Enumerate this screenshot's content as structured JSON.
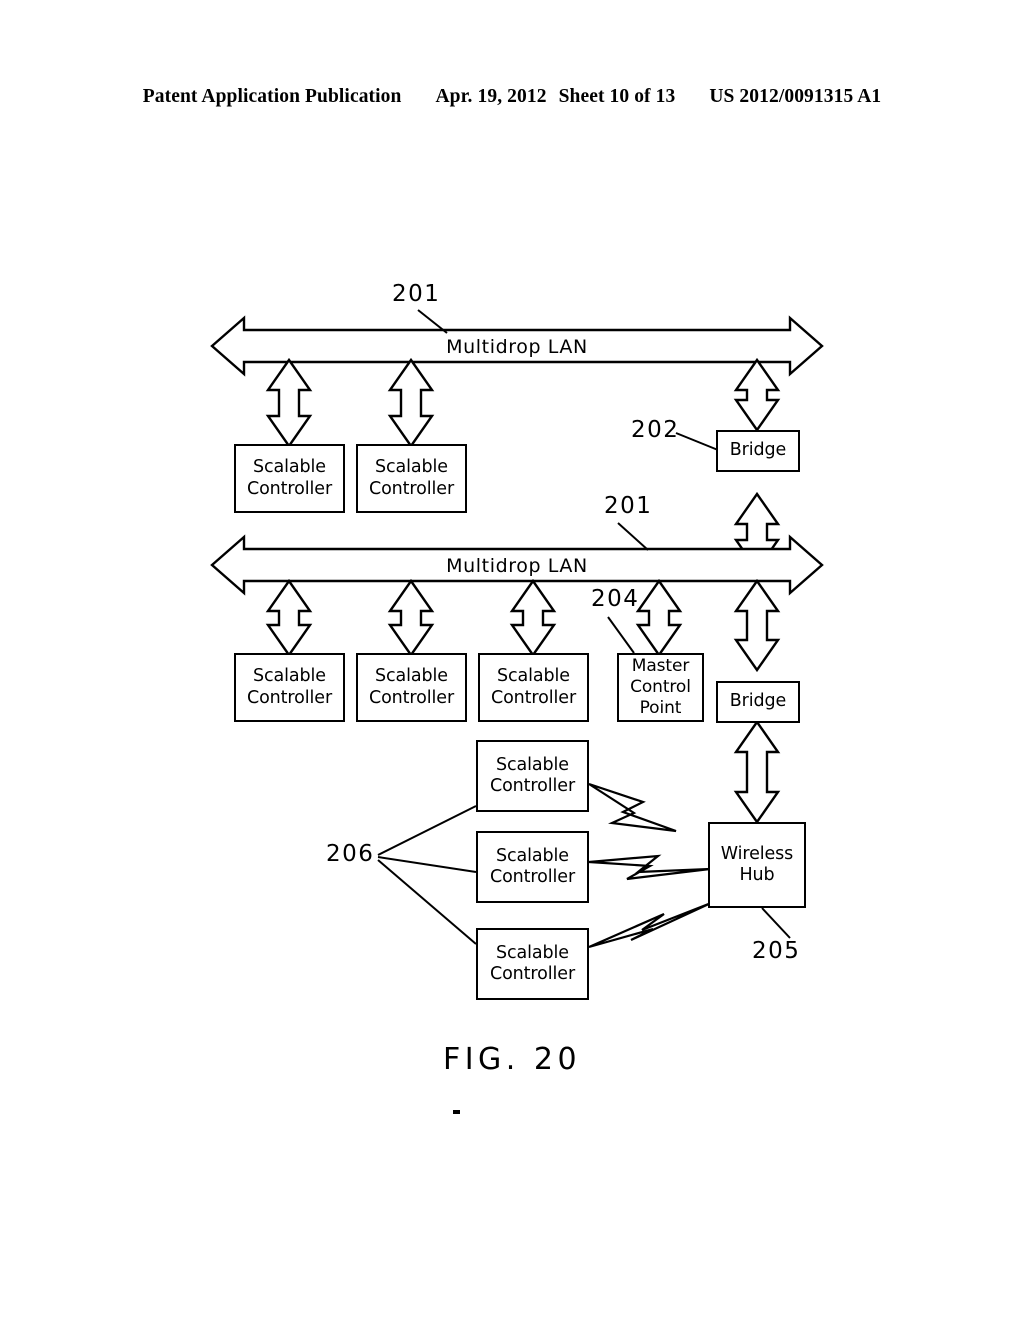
{
  "header": {
    "publication": "Patent Application Publication",
    "date": "Apr. 19, 2012",
    "sheet": "Sheet 10 of 13",
    "doc_number": "US 2012/0091315 A1"
  },
  "figure": {
    "caption": "FIG. 20"
  },
  "diagram": {
    "lan_top": {
      "label": "Multidrop LAN",
      "ref": "201"
    },
    "lan_bottom": {
      "label": "Multidrop LAN",
      "ref": "201"
    },
    "row1_controllers": [
      {
        "line1": "Scalable",
        "line2": "Controller"
      },
      {
        "line1": "Scalable",
        "line2": "Controller"
      }
    ],
    "bridge_top": {
      "label": "Bridge",
      "ref": "202"
    },
    "row2_controllers": [
      {
        "line1": "Scalable",
        "line2": "Controller"
      },
      {
        "line1": "Scalable",
        "line2": "Controller"
      },
      {
        "line1": "Scalable",
        "line2": "Controller"
      }
    ],
    "master_control_point": {
      "line1": "Master",
      "line2": "Control",
      "line3": "Point",
      "ref": "204"
    },
    "bridge_bottom": {
      "label": "Bridge"
    },
    "wireless_hub": {
      "line1": "Wireless",
      "line2": "Hub",
      "ref": "205"
    },
    "wireless_controllers": [
      {
        "line1": "Scalable",
        "line2": "Controller"
      },
      {
        "line1": "Scalable",
        "line2": "Controller"
      },
      {
        "line1": "Scalable",
        "line2": "Controller"
      }
    ],
    "wireless_group_ref": "206"
  },
  "colors": {
    "ink": "#000000",
    "paper": "#ffffff"
  }
}
